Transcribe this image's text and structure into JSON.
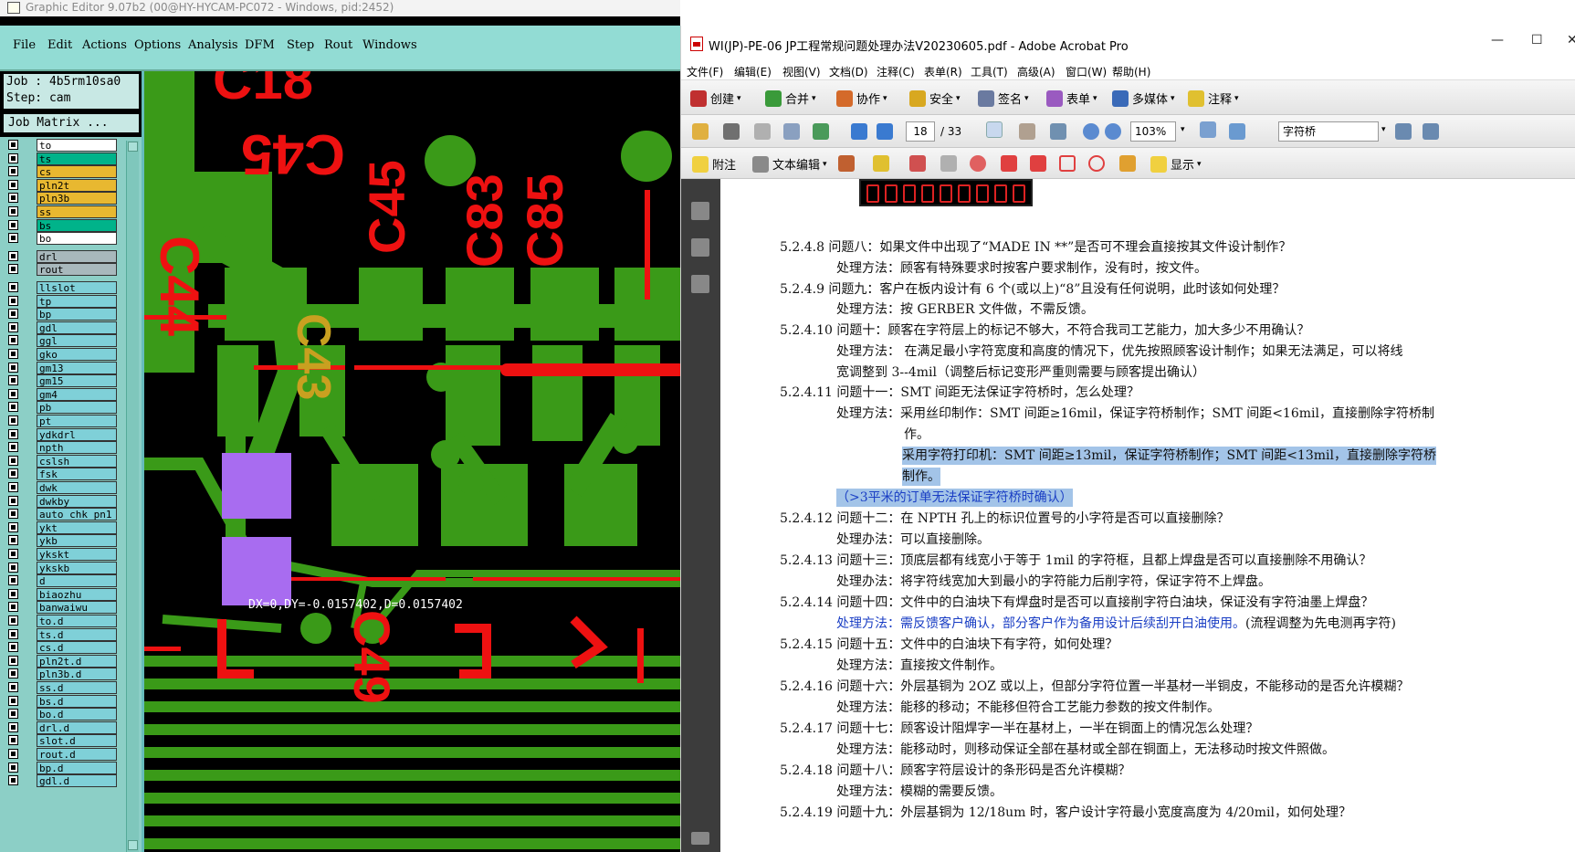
{
  "graphic_editor": {
    "window_title": "Graphic Editor 9.07b2 (00@HY-HYCAM-PC072 - Windows, pid:2452)",
    "menu": [
      "File",
      "Edit",
      "Actions",
      "Options",
      "Analysis",
      "DFM",
      "Step",
      "Rout",
      "Windows"
    ],
    "job_label": "Job  :  4b5rm10sa0",
    "step_label": "Step:  cam",
    "job_matrix_button": "Job Matrix ...",
    "layers": [
      {
        "name": "to",
        "color": "#ffffff"
      },
      {
        "name": "ts",
        "color": "#00b38a"
      },
      {
        "name": "cs",
        "color": "#e8b830"
      },
      {
        "name": "pln2t",
        "color": "#e8b830"
      },
      {
        "name": "pln3b",
        "color": "#e8b830"
      },
      {
        "name": "ss",
        "color": "#e8b830"
      },
      {
        "name": "bs",
        "color": "#00b38a"
      },
      {
        "name": "bo",
        "color": "#ffffff"
      },
      {
        "name": "drl",
        "color": "#a8b8bc"
      },
      {
        "name": "rout",
        "color": "#a8b8bc"
      },
      {
        "name": "llslot",
        "color": "#7fd0d8"
      },
      {
        "name": "tp",
        "color": "#7fd0d8"
      },
      {
        "name": "bp",
        "color": "#7fd0d8"
      },
      {
        "name": "gdl",
        "color": "#7fd0d8"
      },
      {
        "name": "ggl",
        "color": "#7fd0d8"
      },
      {
        "name": "gko",
        "color": "#7fd0d8"
      },
      {
        "name": "gm13",
        "color": "#7fd0d8"
      },
      {
        "name": "gm15",
        "color": "#7fd0d8"
      },
      {
        "name": "gm4",
        "color": "#7fd0d8"
      },
      {
        "name": "pb",
        "color": "#7fd0d8"
      },
      {
        "name": "pt",
        "color": "#7fd0d8"
      },
      {
        "name": "ydkdrl",
        "color": "#7fd0d8"
      },
      {
        "name": "npth",
        "color": "#7fd0d8"
      },
      {
        "name": "cslsh",
        "color": "#7fd0d8"
      },
      {
        "name": "fsk",
        "color": "#7fd0d8"
      },
      {
        "name": "dwk",
        "color": "#7fd0d8"
      },
      {
        "name": "dwkby",
        "color": "#7fd0d8"
      },
      {
        "name": "auto_chk_pn1",
        "color": "#7fd0d8"
      },
      {
        "name": "ykt",
        "color": "#7fd0d8"
      },
      {
        "name": "ykb",
        "color": "#7fd0d8"
      },
      {
        "name": "ykskt",
        "color": "#7fd0d8"
      },
      {
        "name": "ykskb",
        "color": "#7fd0d8"
      },
      {
        "name": "d",
        "color": "#7fd0d8"
      },
      {
        "name": "biaozhu",
        "color": "#7fd0d8"
      },
      {
        "name": "banwaiwu",
        "color": "#7fd0d8"
      },
      {
        "name": "to.d",
        "color": "#7fd0d8"
      },
      {
        "name": "ts.d",
        "color": "#7fd0d8"
      },
      {
        "name": "cs.d",
        "color": "#7fd0d8"
      },
      {
        "name": "pln2t.d",
        "color": "#7fd0d8"
      },
      {
        "name": "pln3b.d",
        "color": "#7fd0d8"
      },
      {
        "name": "ss.d",
        "color": "#7fd0d8"
      },
      {
        "name": "bs.d",
        "color": "#7fd0d8"
      },
      {
        "name": "bo.d",
        "color": "#7fd0d8"
      },
      {
        "name": "drl.d",
        "color": "#7fd0d8"
      },
      {
        "name": "slot.d",
        "color": "#7fd0d8"
      },
      {
        "name": "rout.d",
        "color": "#7fd0d8"
      },
      {
        "name": "bp.d",
        "color": "#7fd0d8"
      },
      {
        "name": "gdl.d",
        "color": "#7fd0d8"
      }
    ],
    "canvas_labels": [
      {
        "text": "C18",
        "color": "#ee1111"
      },
      {
        "text": "C45",
        "color": "#ee1111"
      },
      {
        "text": "C45",
        "color": "#ee1111"
      },
      {
        "text": "C83",
        "color": "#ee1111"
      },
      {
        "text": "C85",
        "color": "#ee1111"
      },
      {
        "text": "C44",
        "color": "#ee1111"
      },
      {
        "text": "C43",
        "color": "#c9a020"
      },
      {
        "text": "C49",
        "color": "#ee1111"
      }
    ],
    "measure_text": "DX=0,DY=-0.0157402,D=0.0157402",
    "colors": {
      "copper": "#3a9a18",
      "silk": "#ee1111",
      "silk_yellow": "#c9a020",
      "pad_select": "#a86cf0"
    }
  },
  "acrobat": {
    "window_title": "WI(JP)-PE-06 JP工程常规问题处理办法V20230605.pdf - Adobe Acrobat Pro",
    "menu": [
      "文件(F)",
      "编辑(E)",
      "视图(V)",
      "文档(D)",
      "注释(C)",
      "表单(R)",
      "工具(T)",
      "高级(A)",
      "窗口(W)",
      "帮助(H)"
    ],
    "toolbar1": [
      "创建",
      "合并",
      "协作",
      "安全",
      "签名",
      "表单",
      "多媒体",
      "注释"
    ],
    "page_current": "18",
    "page_total": "/ 33",
    "zoom": "103%",
    "search_value": "字符桥",
    "toolbar3": [
      "附注",
      "文本编辑",
      "显示"
    ],
    "doc_lines": [
      {
        "text": "5.2.4.8  问题八：如果文件中出现了“MADE IN **”是否可不理会直接按其文件设计制作？",
        "indent": 0,
        "style": "normal"
      },
      {
        "text": "处理方法：顾客有特殊要求时按客户要求制作，没有时，按文件。",
        "indent": 1,
        "style": "normal"
      },
      {
        "text": "5.2.4.9  问题九：客户在板内设计有 6 个(或以上)“8”且没有任何说明，此时该如何处理？",
        "indent": 0,
        "style": "normal"
      },
      {
        "text": "处理方法：按 GERBER 文件做，不需反馈。",
        "indent": 1,
        "style": "normal"
      },
      {
        "text": "5.2.4.10  问题十：顾客在字符层上的标记不够大，不符合我司工艺能力，加大多少不用确认？",
        "indent": 0,
        "style": "normal"
      },
      {
        "text": "处理方法：  在满足最小字符宽度和高度的情况下，优先按照顾客设计制作；如果无法满足，可以将线",
        "indent": 1,
        "style": "normal"
      },
      {
        "text": "宽调整到 3--4mil（调整后标记变形严重则需要与顾客提出确认）",
        "indent": 1,
        "style": "normal"
      },
      {
        "text": "5.2.4.11  问题十一：SMT 间距无法保证字符桥时，怎么处理？",
        "indent": 0,
        "style": "normal"
      },
      {
        "text": "处理方法：采用丝印制作：SMT 间距≥16mil，保证字符桥制作；SMT 间距<16mil，直接删除字符桥制",
        "indent": 1,
        "style": "normal"
      },
      {
        "text": "作。",
        "indent": 2,
        "style": "normal"
      },
      {
        "text": "采用字符打印机：SMT 间距≥13mil，保证字符桥制作；SMT 间距<13mil，直接删除字符桥",
        "indent": 3,
        "style": "highlight"
      },
      {
        "text": "制作。",
        "indent": 3,
        "style": "highlight"
      },
      {
        "text": "（>3平米的订单无法保证字符桥时确认）",
        "indent": 1,
        "style": "highlight-blue"
      },
      {
        "text": "5.2.4.12  问题十二：在 NPTH 孔上的标识位置号的小字符是否可以直接删除？",
        "indent": 0,
        "style": "normal"
      },
      {
        "text": "处理办法：可以直接删除。",
        "indent": 1,
        "style": "normal"
      },
      {
        "text": "5.2.4.13  问题十三：顶底层都有线宽小于等于 1mil 的字符框，且都上焊盘是否可以直接删除不用确认？",
        "indent": 0,
        "style": "normal"
      },
      {
        "text": "处理办法：将字符线宽加大到最小的字符能力后削字符，保证字符不上焊盘。",
        "indent": 1,
        "style": "normal"
      },
      {
        "text": "5.2.4.14  问题十四：文件中的白油块下有焊盘时是否可以直接削字符白油块，保证没有字符油墨上焊盘？",
        "indent": 0,
        "style": "normal"
      },
      {
        "text": "处理方法：需反馈客户确认，部分客户作为备用设计后续刮开白油使用。(流程调整为先电测再字符)",
        "indent": 1,
        "style": "mixed"
      },
      {
        "text": "5.2.4.15  问题十五：文件中的白油块下有字符，如何处理？",
        "indent": 0,
        "style": "normal"
      },
      {
        "text": "处理方法：直接按文件制作。",
        "indent": 1,
        "style": "normal"
      },
      {
        "text": "5.2.4.16  问题十六：外层基铜为 2OZ 或以上，但部分字符位置一半基材一半铜皮，不能移动的是否允许模糊？",
        "indent": 0,
        "style": "normal"
      },
      {
        "text": "处理方法：能移的移动；不能移但符合工艺能力参数的按文件制作。",
        "indent": 1,
        "style": "normal"
      },
      {
        "text": "5.2.4.17  问题十七：顾客设计阻焊字一半在基材上，一半在铜面上的情况怎么处理？",
        "indent": 0,
        "style": "normal"
      },
      {
        "text": "处理方法：能移动时，则移动保证全部在基材或全部在铜面上，无法移动时按文件照做。",
        "indent": 1,
        "style": "normal"
      },
      {
        "text": "5.2.4.18  问题十八：顾客字符层设计的条形码是否允许模糊？",
        "indent": 0,
        "style": "normal"
      },
      {
        "text": "处理方法：模糊的需要反馈。",
        "indent": 1,
        "style": "normal"
      },
      {
        "text": "5.2.4.19  问题十九：外层基铜为 12/18um 时，客户设计字符最小宽度高度为 4/20mil，如何处理？",
        "indent": 0,
        "style": "normal"
      }
    ],
    "blue_part": "处理方法：需反馈客户确认，部分客户作为备用设计后续刮开白油使用。",
    "black_part": "(流程调整为先电测再字符)"
  }
}
